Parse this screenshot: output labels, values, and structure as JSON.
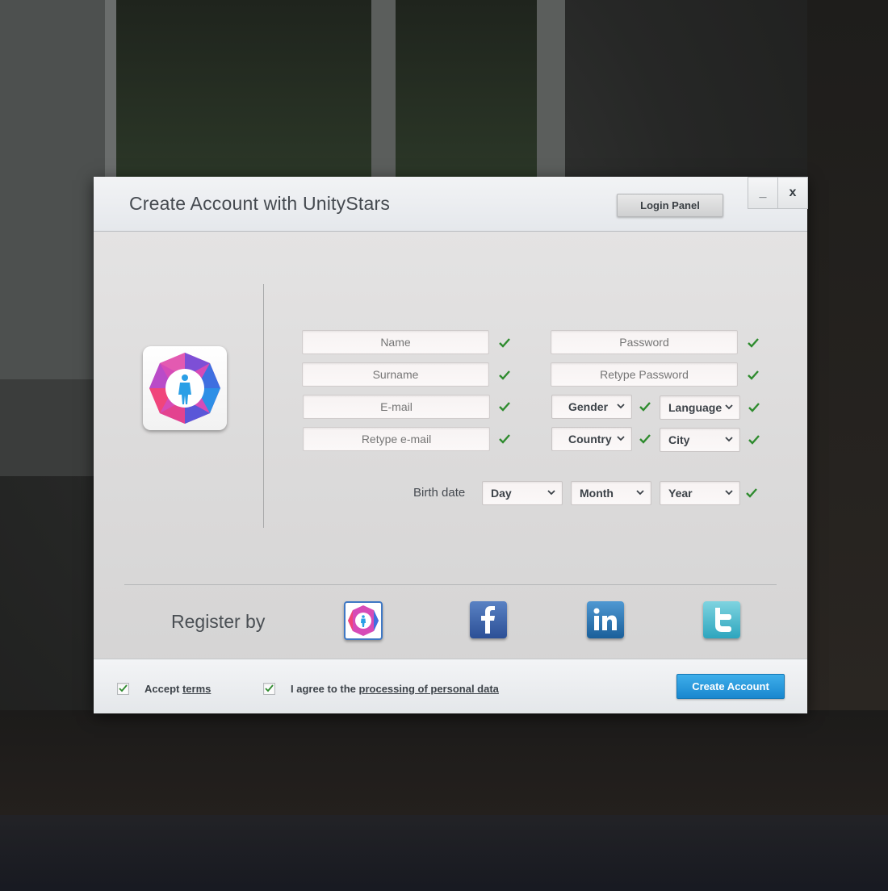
{
  "dialog": {
    "title": "Create Account with UnityStars",
    "login_panel_label": "Login Panel",
    "minimize_label": "_",
    "close_label": "x"
  },
  "form": {
    "name_placeholder": "Name",
    "surname_placeholder": "Surname",
    "email_placeholder": "E-mail",
    "retype_email_placeholder": "Retype e-mail",
    "password_placeholder": "Password",
    "retype_password_placeholder": "Retype Password",
    "gender_label": "Gender",
    "language_label": "Language",
    "country_label": "Country",
    "city_label": "City",
    "birth_date_label": "Birth date",
    "day_label": "Day",
    "month_label": "Month",
    "year_label": "Year"
  },
  "register": {
    "label": "Register by",
    "providers": [
      "unitystars-icon",
      "facebook-icon",
      "linkedin-icon",
      "twitter-icon"
    ]
  },
  "footer": {
    "accept_prefix": "Accept ",
    "accept_link": "terms",
    "accept_checked": true,
    "agree_prefix": "I agree to the ",
    "agree_link": "processing of personal data",
    "agree_checked": true,
    "create_account_label": "Create Account"
  },
  "colors": {
    "accent_blue": "#1987cf",
    "check_green": "#2e8b2e",
    "title_text": "#454a50"
  }
}
